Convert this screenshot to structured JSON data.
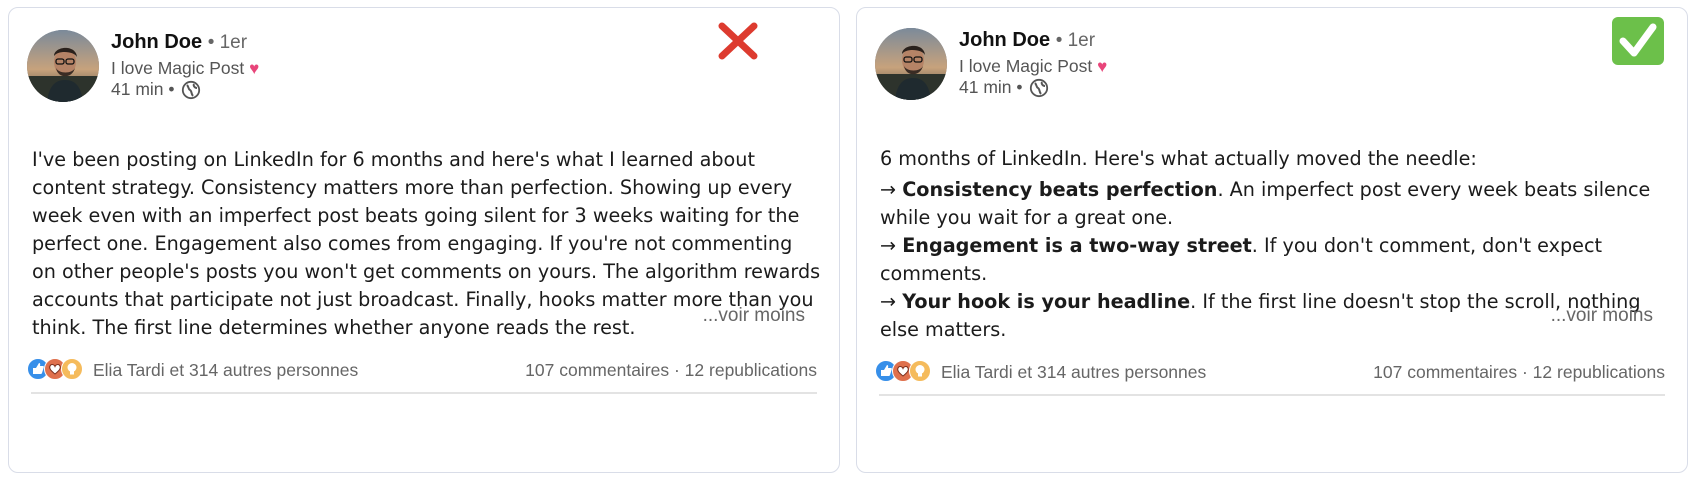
{
  "cards": [
    {
      "status": "bad",
      "author": {
        "name": "John Doe",
        "degree": "• 1er",
        "headline": "I love Magic Post",
        "headline_emoji": "♥",
        "time": "41 min •"
      },
      "post_paragraphs": [
        "I've been posting on LinkedIn for 6 months and here's what I learned about content strategy. Consistency matters more than perfection. Showing up every week even with an imperfect post beats going silent for 3 weeks waiting for the perfect one. Engagement also comes from engaging. If you're not commenting on other people's posts you won't get comments on yours. The algorithm rewards accounts that participate not just broadcast. Finally, hooks matter more than you think. The first line determines whether anyone reads the rest."
      ],
      "see_less": "...voir moins",
      "reactions_text": "Elia Tardi et 314 autres personnes",
      "stats_text": "107 commentaires · 12 republications"
    },
    {
      "status": "good",
      "author": {
        "name": "John Doe",
        "degree": "• 1er",
        "headline": "I love Magic Post",
        "headline_emoji": "♥",
        "time": "41 min •"
      },
      "post_intro": "6 months of LinkedIn. Here's what actually moved the needle:",
      "post_points": [
        {
          "arrow": "→ ",
          "bold": "Consistency beats perfection",
          "rest": ". An imperfect post every week beats silence while you wait for a great one."
        },
        {
          "arrow": "→ ",
          "bold": "Engagement is a two-way street",
          "rest": ". If you don't comment, don't expect comments."
        },
        {
          "arrow": "→ ",
          "bold": "Your hook is your headline",
          "rest": ". If the first line doesn't stop the scroll, nothing else matters."
        }
      ],
      "see_less": "...voir moins",
      "reactions_text": "Elia Tardi et 314 autres personnes",
      "stats_text": "107 commentaires · 12 republications"
    }
  ],
  "icons": {
    "bad_mark": "red-cross-mark-icon",
    "good_mark": "green-check-mark-icon",
    "globe": "globe-icon",
    "reactions": [
      "like-icon",
      "love-icon",
      "insightful-icon"
    ]
  },
  "colors": {
    "cross": "#dd3b2f",
    "check": "#6cc04a",
    "like": "#378fe9",
    "love": "#df704d",
    "insightful": "#f5bb5c"
  }
}
